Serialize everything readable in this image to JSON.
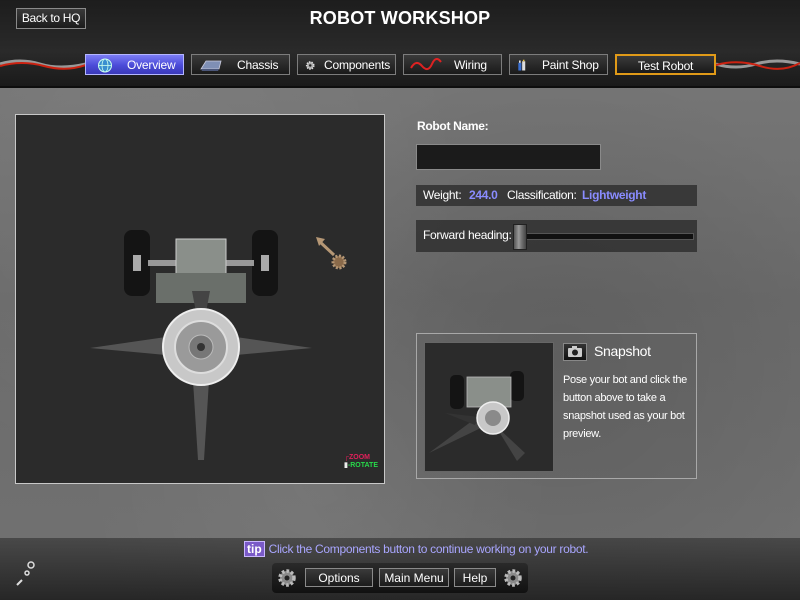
{
  "header": {
    "title": "ROBOT WORKSHOP",
    "back_label": "Back to HQ"
  },
  "tabs": [
    {
      "label": "Overview",
      "icon": "globe-icon",
      "active": true
    },
    {
      "label": "Chassis",
      "icon": "chassis-icon",
      "active": false
    },
    {
      "label": "Components",
      "icon": "gear-icon",
      "active": false
    },
    {
      "label": "Wiring",
      "icon": "wire-icon",
      "active": false
    },
    {
      "label": "Paint Shop",
      "icon": "paint-icon",
      "active": false
    },
    {
      "label": "Test Robot",
      "icon": "",
      "active": false
    }
  ],
  "viewport": {
    "legend_zoom": "ZOOM",
    "legend_rotate": "ROTATE",
    "zoom_color": "#e0205a",
    "rotate_color": "#27d84a"
  },
  "robot": {
    "name_label": "Robot Name:",
    "name_value": "",
    "weight_label": "Weight:",
    "weight_value": "244.0",
    "class_label": "Classification:",
    "class_value": "Lightweight",
    "heading_label": "Forward heading:",
    "heading_value": 0
  },
  "snapshot": {
    "title": "Snapshot",
    "text": "Pose your bot and click the button above to take a snapshot used as your bot preview."
  },
  "footer": {
    "tip_badge": "tip",
    "tip_text": "Click the Components button to continue working on your robot.",
    "options_label": "Options",
    "main_menu_label": "Main Menu",
    "help_label": "Help"
  },
  "colors": {
    "accent": "#4b4bd8",
    "value_text": "#8a8cff",
    "tip_text": "#a9a6ff",
    "hazard": "#e09a18"
  }
}
